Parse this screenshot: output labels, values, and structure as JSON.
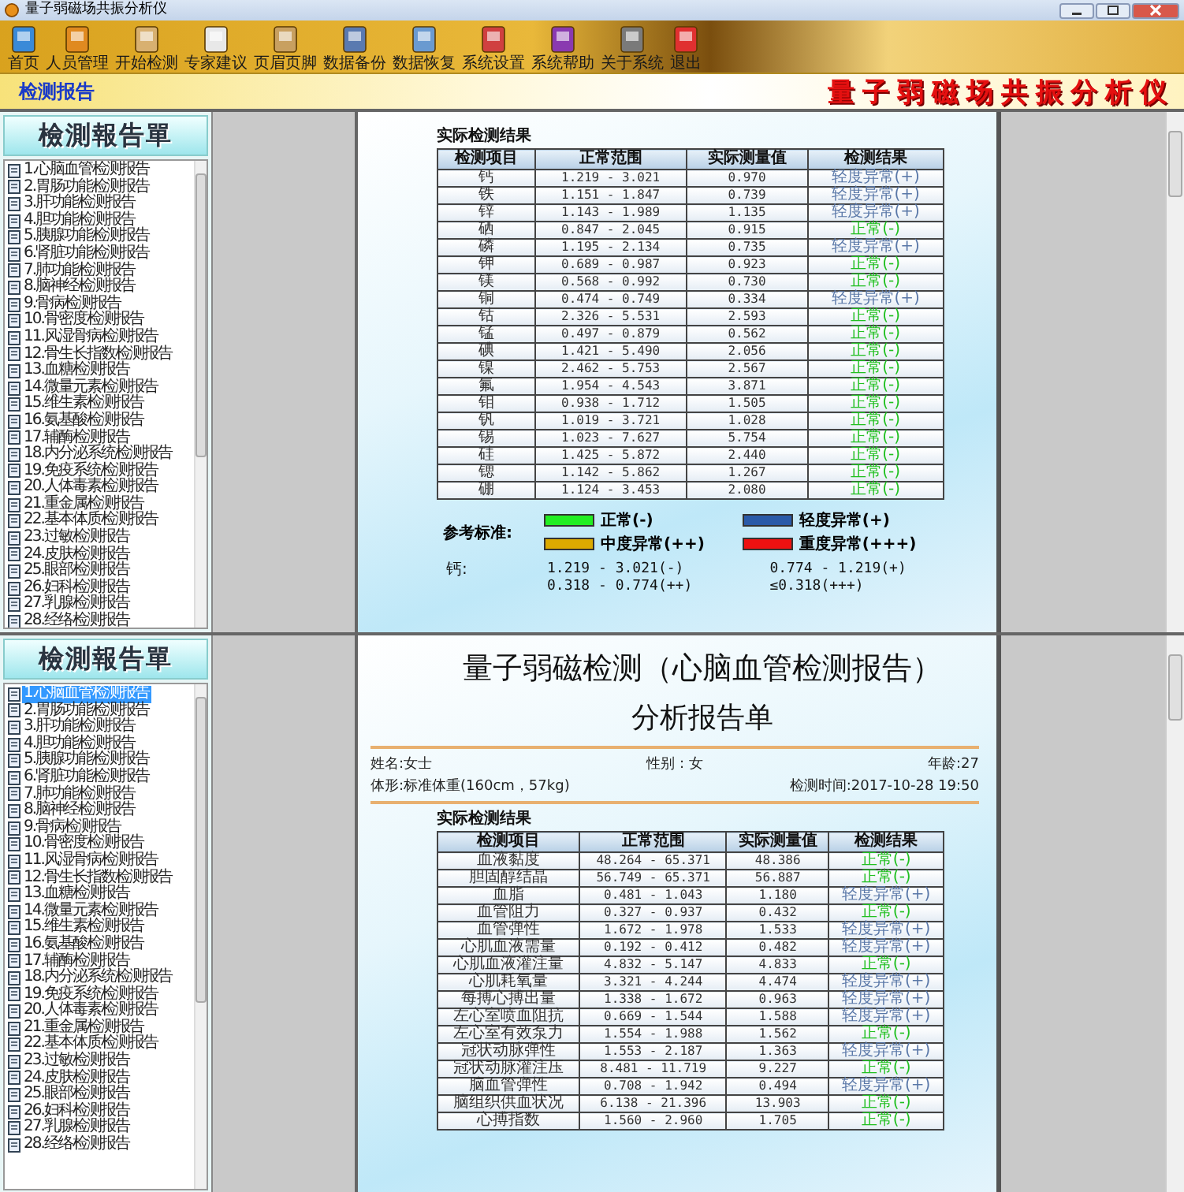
{
  "window": {
    "title": "量子弱磁场共振分析仪"
  },
  "toolbar": [
    {
      "label": "首页"
    },
    {
      "label": "人员管理"
    },
    {
      "label": "开始检测"
    },
    {
      "label": "专家建议"
    },
    {
      "label": "页眉页脚"
    },
    {
      "label": "数据备份"
    },
    {
      "label": "数据恢复"
    },
    {
      "label": "系统设置"
    },
    {
      "label": "系统帮助"
    },
    {
      "label": "关于系统"
    },
    {
      "label": "退出"
    }
  ],
  "header": {
    "title": "检测报告",
    "brand": "量子弱磁场共振分析仪"
  },
  "panes": [
    {
      "sidebar": {
        "title": "檢測報告單",
        "items": [
          {
            "label": "1.心脑血管检测报告",
            "selected": false
          },
          {
            "label": "2.胃肠功能检测报告",
            "selected": false
          },
          {
            "label": "3.肝功能检测报告",
            "selected": false
          },
          {
            "label": "4.胆功能检测报告",
            "selected": false
          },
          {
            "label": "5.胰腺功能检测报告",
            "selected": false
          },
          {
            "label": "6.肾脏功能检测报告",
            "selected": false
          },
          {
            "label": "7.肺功能检测报告",
            "selected": false
          },
          {
            "label": "8.脑神经检测报告",
            "selected": false
          },
          {
            "label": "9.骨病检测报告",
            "selected": false
          },
          {
            "label": "10.骨密度检测报告",
            "selected": false
          },
          {
            "label": "11.风湿骨病检测报告",
            "selected": false
          },
          {
            "label": "12.骨生长指数检测报告",
            "selected": false
          },
          {
            "label": "13.血糖检测报告",
            "selected": false
          },
          {
            "label": "14.微量元素检测报告",
            "selected": false
          },
          {
            "label": "15.维生素检测报告",
            "selected": false
          },
          {
            "label": "16.氨基酸检测报告",
            "selected": false
          },
          {
            "label": "17.辅酶检测报告",
            "selected": false
          },
          {
            "label": "18.内分泌系统检测报告",
            "selected": false
          },
          {
            "label": "19.免疫系统检测报告",
            "selected": false
          },
          {
            "label": "20.人体毒素检测报告",
            "selected": false
          },
          {
            "label": "21.重金属检测报告",
            "selected": false
          },
          {
            "label": "22.基本体质检测报告",
            "selected": false
          },
          {
            "label": "23.过敏检测报告",
            "selected": false
          },
          {
            "label": "24.皮肤检测报告",
            "selected": false
          },
          {
            "label": "25.眼部检测报告",
            "selected": false
          },
          {
            "label": "26.妇科检测报告",
            "selected": false
          },
          {
            "label": "27.乳腺检测报告",
            "selected": false
          },
          {
            "label": "28.经络检测报告",
            "selected": false
          }
        ]
      },
      "report": {
        "section_title": "实际检测结果",
        "columns": [
          "检测项目",
          "正常范围",
          "实际测量值",
          "检测结果"
        ],
        "rows": [
          {
            "item": "钙",
            "range": "1.219 - 3.021",
            "value": "0.970",
            "result": "轻度异常(+)",
            "kind": "mild"
          },
          {
            "item": "铁",
            "range": "1.151 - 1.847",
            "value": "0.739",
            "result": "轻度异常(+)",
            "kind": "mild"
          },
          {
            "item": "锌",
            "range": "1.143 - 1.989",
            "value": "1.135",
            "result": "轻度异常(+)",
            "kind": "mild"
          },
          {
            "item": "硒",
            "range": "0.847 - 2.045",
            "value": "0.915",
            "result": "正常(-)",
            "kind": "normal"
          },
          {
            "item": "磷",
            "range": "1.195 - 2.134",
            "value": "0.735",
            "result": "轻度异常(+)",
            "kind": "mild"
          },
          {
            "item": "钾",
            "range": "0.689 - 0.987",
            "value": "0.923",
            "result": "正常(-)",
            "kind": "normal"
          },
          {
            "item": "镁",
            "range": "0.568 - 0.992",
            "value": "0.730",
            "result": "正常(-)",
            "kind": "normal"
          },
          {
            "item": "铜",
            "range": "0.474 - 0.749",
            "value": "0.334",
            "result": "轻度异常(+)",
            "kind": "mild"
          },
          {
            "item": "钴",
            "range": "2.326 - 5.531",
            "value": "2.593",
            "result": "正常(-)",
            "kind": "normal"
          },
          {
            "item": "锰",
            "range": "0.497 - 0.879",
            "value": "0.562",
            "result": "正常(-)",
            "kind": "normal"
          },
          {
            "item": "碘",
            "range": "1.421 - 5.490",
            "value": "2.056",
            "result": "正常(-)",
            "kind": "normal"
          },
          {
            "item": "镍",
            "range": "2.462 - 5.753",
            "value": "2.567",
            "result": "正常(-)",
            "kind": "normal"
          },
          {
            "item": "氟",
            "range": "1.954 - 4.543",
            "value": "3.871",
            "result": "正常(-)",
            "kind": "normal"
          },
          {
            "item": "钼",
            "range": "0.938 - 1.712",
            "value": "1.505",
            "result": "正常(-)",
            "kind": "normal"
          },
          {
            "item": "钒",
            "range": "1.019 - 3.721",
            "value": "1.028",
            "result": "正常(-)",
            "kind": "normal"
          },
          {
            "item": "锡",
            "range": "1.023 - 7.627",
            "value": "5.754",
            "result": "正常(-)",
            "kind": "normal"
          },
          {
            "item": "硅",
            "range": "1.425 - 5.872",
            "value": "2.440",
            "result": "正常(-)",
            "kind": "normal"
          },
          {
            "item": "锶",
            "range": "1.142 - 5.862",
            "value": "1.267",
            "result": "正常(-)",
            "kind": "normal"
          },
          {
            "item": "硼",
            "range": "1.124 - 3.453",
            "value": "2.080",
            "result": "正常(-)",
            "kind": "normal"
          }
        ],
        "legend": {
          "label": "参考标准:",
          "items": [
            {
              "label": "正常(-)",
              "color": "#22ee22"
            },
            {
              "label": "轻度异常(+)",
              "color": "#2a5aa8"
            },
            {
              "label": "中度异常(++)",
              "color": "#dcaa00"
            },
            {
              "label": "重度异常(+++)",
              "color": "#ee1111"
            }
          ]
        },
        "reference": {
          "label": "钙:",
          "ranges": [
            "1.219 - 3.021(-)",
            "0.774 - 1.219(+)",
            "0.318 - 0.774(++)",
            "≤0.318(+++)"
          ]
        }
      }
    },
    {
      "sidebar": {
        "title": "檢測報告單",
        "items": [
          {
            "label": "1.心脑血管检测报告",
            "selected": true
          },
          {
            "label": "2.胃肠功能检测报告",
            "selected": false
          },
          {
            "label": "3.肝功能检测报告",
            "selected": false
          },
          {
            "label": "4.胆功能检测报告",
            "selected": false
          },
          {
            "label": "5.胰腺功能检测报告",
            "selected": false
          },
          {
            "label": "6.肾脏功能检测报告",
            "selected": false
          },
          {
            "label": "7.肺功能检测报告",
            "selected": false
          },
          {
            "label": "8.脑神经检测报告",
            "selected": false
          },
          {
            "label": "9.骨病检测报告",
            "selected": false
          },
          {
            "label": "10.骨密度检测报告",
            "selected": false
          },
          {
            "label": "11.风湿骨病检测报告",
            "selected": false
          },
          {
            "label": "12.骨生长指数检测报告",
            "selected": false
          },
          {
            "label": "13.血糖检测报告",
            "selected": false
          },
          {
            "label": "14.微量元素检测报告",
            "selected": false
          },
          {
            "label": "15.维生素检测报告",
            "selected": false
          },
          {
            "label": "16.氨基酸检测报告",
            "selected": false
          },
          {
            "label": "17.辅酶检测报告",
            "selected": false
          },
          {
            "label": "18.内分泌系统检测报告",
            "selected": false
          },
          {
            "label": "19.免疫系统检测报告",
            "selected": false
          },
          {
            "label": "20.人体毒素检测报告",
            "selected": false
          },
          {
            "label": "21.重金属检测报告",
            "selected": false
          },
          {
            "label": "22.基本体质检测报告",
            "selected": false
          },
          {
            "label": "23.过敏检测报告",
            "selected": false
          },
          {
            "label": "24.皮肤检测报告",
            "selected": false
          },
          {
            "label": "25.眼部检测报告",
            "selected": false
          },
          {
            "label": "26.妇科检测报告",
            "selected": false
          },
          {
            "label": "27.乳腺检测报告",
            "selected": false
          },
          {
            "label": "28.经络检测报告",
            "selected": false
          }
        ]
      },
      "report": {
        "title": "量子弱磁检测（心脑血管检测报告）",
        "subtitle": "分析报告单",
        "info": [
          "姓名:女士",
          "性别 : 女",
          "年龄:27",
          "体形:标准体重(160cm，57kg)",
          "检测时间:2017-10-28 19:50"
        ],
        "section_title": "实际检测结果",
        "columns": [
          "检测项目",
          "正常范围",
          "实际测量值",
          "检测结果"
        ],
        "rows": [
          {
            "item": "血液黏度",
            "range": "48.264 - 65.371",
            "value": "48.386",
            "result": "正常(-)",
            "kind": "normal"
          },
          {
            "item": "胆固醇结晶",
            "range": "56.749 - 65.371",
            "value": "56.887",
            "result": "正常(-)",
            "kind": "normal"
          },
          {
            "item": "血脂",
            "range": "0.481 - 1.043",
            "value": "1.180",
            "result": "轻度异常(+)",
            "kind": "mild"
          },
          {
            "item": "血管阻力",
            "range": "0.327 - 0.937",
            "value": "0.432",
            "result": "正常(-)",
            "kind": "normal"
          },
          {
            "item": "血管弹性",
            "range": "1.672 - 1.978",
            "value": "1.533",
            "result": "轻度异常(+)",
            "kind": "mild"
          },
          {
            "item": "心肌血液需量",
            "range": "0.192 - 0.412",
            "value": "0.482",
            "result": "轻度异常(+)",
            "kind": "mild"
          },
          {
            "item": "心肌血液灌注量",
            "range": "4.832 - 5.147",
            "value": "4.833",
            "result": "正常(-)",
            "kind": "normal"
          },
          {
            "item": "心肌耗氧量",
            "range": "3.321 - 4.244",
            "value": "4.474",
            "result": "轻度异常(+)",
            "kind": "mild"
          },
          {
            "item": "每搏心搏出量",
            "range": "1.338 - 1.672",
            "value": "0.963",
            "result": "轻度异常(+)",
            "kind": "mild"
          },
          {
            "item": "左心室喷血阻抗",
            "range": "0.669 - 1.544",
            "value": "1.588",
            "result": "轻度异常(+)",
            "kind": "mild"
          },
          {
            "item": "左心室有效泵力",
            "range": "1.554 - 1.988",
            "value": "1.562",
            "result": "正常(-)",
            "kind": "normal"
          },
          {
            "item": "冠状动脉弹性",
            "range": "1.553 - 2.187",
            "value": "1.363",
            "result": "轻度异常(+)",
            "kind": "mild"
          },
          {
            "item": "冠状动脉灌注压",
            "range": "8.481 - 11.719",
            "value": "9.227",
            "result": "正常(-)",
            "kind": "normal"
          },
          {
            "item": "脑血管弹性",
            "range": "0.708 - 1.942",
            "value": "0.494",
            "result": "轻度异常(+)",
            "kind": "mild"
          },
          {
            "item": "脑组织供血状况",
            "range": "6.138 - 21.396",
            "value": "13.903",
            "result": "正常(-)",
            "kind": "normal"
          },
          {
            "item": "心搏指数",
            "range": "1.560 - 2.960",
            "value": "1.705",
            "result": "正常(-)",
            "kind": "normal"
          }
        ]
      }
    }
  ]
}
